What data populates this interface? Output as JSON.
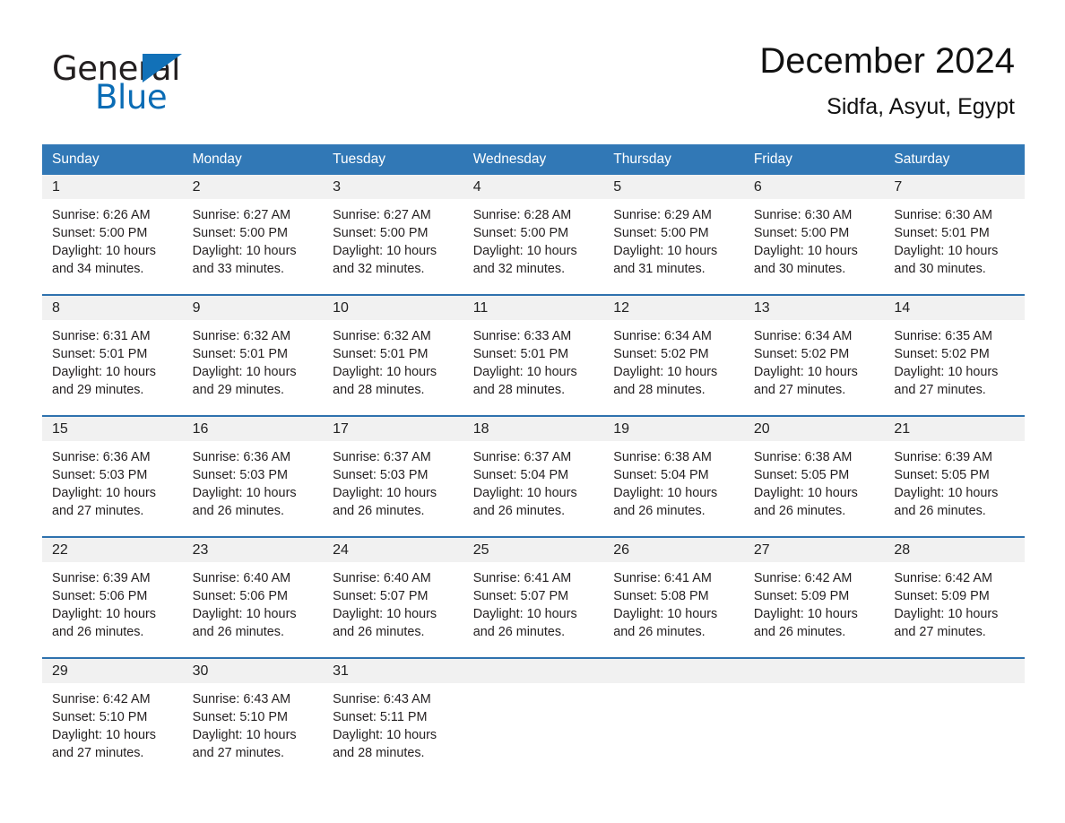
{
  "brand": {
    "name_part1": "General",
    "name_part2": "Blue",
    "triangle_color": "#1271b8"
  },
  "header": {
    "month_title": "December 2024",
    "location": "Sidfa, Asyut, Egypt"
  },
  "theme": {
    "header_blue": "#3178b6",
    "row_rule_blue": "#2f72ae",
    "daynum_band": "#f1f1f1",
    "text": "#231f20"
  },
  "calendar": {
    "weekday_headers": [
      "Sunday",
      "Monday",
      "Tuesday",
      "Wednesday",
      "Thursday",
      "Friday",
      "Saturday"
    ],
    "weeks": [
      [
        {
          "day": "1",
          "details": "Sunrise: 6:26 AM\nSunset: 5:00 PM\nDaylight: 10 hours\nand 34 minutes."
        },
        {
          "day": "2",
          "details": "Sunrise: 6:27 AM\nSunset: 5:00 PM\nDaylight: 10 hours\nand 33 minutes."
        },
        {
          "day": "3",
          "details": "Sunrise: 6:27 AM\nSunset: 5:00 PM\nDaylight: 10 hours\nand 32 minutes."
        },
        {
          "day": "4",
          "details": "Sunrise: 6:28 AM\nSunset: 5:00 PM\nDaylight: 10 hours\nand 32 minutes."
        },
        {
          "day": "5",
          "details": "Sunrise: 6:29 AM\nSunset: 5:00 PM\nDaylight: 10 hours\nand 31 minutes."
        },
        {
          "day": "6",
          "details": "Sunrise: 6:30 AM\nSunset: 5:00 PM\nDaylight: 10 hours\nand 30 minutes."
        },
        {
          "day": "7",
          "details": "Sunrise: 6:30 AM\nSunset: 5:01 PM\nDaylight: 10 hours\nand 30 minutes."
        }
      ],
      [
        {
          "day": "8",
          "details": "Sunrise: 6:31 AM\nSunset: 5:01 PM\nDaylight: 10 hours\nand 29 minutes."
        },
        {
          "day": "9",
          "details": "Sunrise: 6:32 AM\nSunset: 5:01 PM\nDaylight: 10 hours\nand 29 minutes."
        },
        {
          "day": "10",
          "details": "Sunrise: 6:32 AM\nSunset: 5:01 PM\nDaylight: 10 hours\nand 28 minutes."
        },
        {
          "day": "11",
          "details": "Sunrise: 6:33 AM\nSunset: 5:01 PM\nDaylight: 10 hours\nand 28 minutes."
        },
        {
          "day": "12",
          "details": "Sunrise: 6:34 AM\nSunset: 5:02 PM\nDaylight: 10 hours\nand 28 minutes."
        },
        {
          "day": "13",
          "details": "Sunrise: 6:34 AM\nSunset: 5:02 PM\nDaylight: 10 hours\nand 27 minutes."
        },
        {
          "day": "14",
          "details": "Sunrise: 6:35 AM\nSunset: 5:02 PM\nDaylight: 10 hours\nand 27 minutes."
        }
      ],
      [
        {
          "day": "15",
          "details": "Sunrise: 6:36 AM\nSunset: 5:03 PM\nDaylight: 10 hours\nand 27 minutes."
        },
        {
          "day": "16",
          "details": "Sunrise: 6:36 AM\nSunset: 5:03 PM\nDaylight: 10 hours\nand 26 minutes."
        },
        {
          "day": "17",
          "details": "Sunrise: 6:37 AM\nSunset: 5:03 PM\nDaylight: 10 hours\nand 26 minutes."
        },
        {
          "day": "18",
          "details": "Sunrise: 6:37 AM\nSunset: 5:04 PM\nDaylight: 10 hours\nand 26 minutes."
        },
        {
          "day": "19",
          "details": "Sunrise: 6:38 AM\nSunset: 5:04 PM\nDaylight: 10 hours\nand 26 minutes."
        },
        {
          "day": "20",
          "details": "Sunrise: 6:38 AM\nSunset: 5:05 PM\nDaylight: 10 hours\nand 26 minutes."
        },
        {
          "day": "21",
          "details": "Sunrise: 6:39 AM\nSunset: 5:05 PM\nDaylight: 10 hours\nand 26 minutes."
        }
      ],
      [
        {
          "day": "22",
          "details": "Sunrise: 6:39 AM\nSunset: 5:06 PM\nDaylight: 10 hours\nand 26 minutes."
        },
        {
          "day": "23",
          "details": "Sunrise: 6:40 AM\nSunset: 5:06 PM\nDaylight: 10 hours\nand 26 minutes."
        },
        {
          "day": "24",
          "details": "Sunrise: 6:40 AM\nSunset: 5:07 PM\nDaylight: 10 hours\nand 26 minutes."
        },
        {
          "day": "25",
          "details": "Sunrise: 6:41 AM\nSunset: 5:07 PM\nDaylight: 10 hours\nand 26 minutes."
        },
        {
          "day": "26",
          "details": "Sunrise: 6:41 AM\nSunset: 5:08 PM\nDaylight: 10 hours\nand 26 minutes."
        },
        {
          "day": "27",
          "details": "Sunrise: 6:42 AM\nSunset: 5:09 PM\nDaylight: 10 hours\nand 26 minutes."
        },
        {
          "day": "28",
          "details": "Sunrise: 6:42 AM\nSunset: 5:09 PM\nDaylight: 10 hours\nand 27 minutes."
        }
      ],
      [
        {
          "day": "29",
          "details": "Sunrise: 6:42 AM\nSunset: 5:10 PM\nDaylight: 10 hours\nand 27 minutes."
        },
        {
          "day": "30",
          "details": "Sunrise: 6:43 AM\nSunset: 5:10 PM\nDaylight: 10 hours\nand 27 minutes."
        },
        {
          "day": "31",
          "details": "Sunrise: 6:43 AM\nSunset: 5:11 PM\nDaylight: 10 hours\nand 28 minutes."
        },
        {
          "day": "",
          "details": ""
        },
        {
          "day": "",
          "details": ""
        },
        {
          "day": "",
          "details": ""
        },
        {
          "day": "",
          "details": ""
        }
      ]
    ]
  }
}
